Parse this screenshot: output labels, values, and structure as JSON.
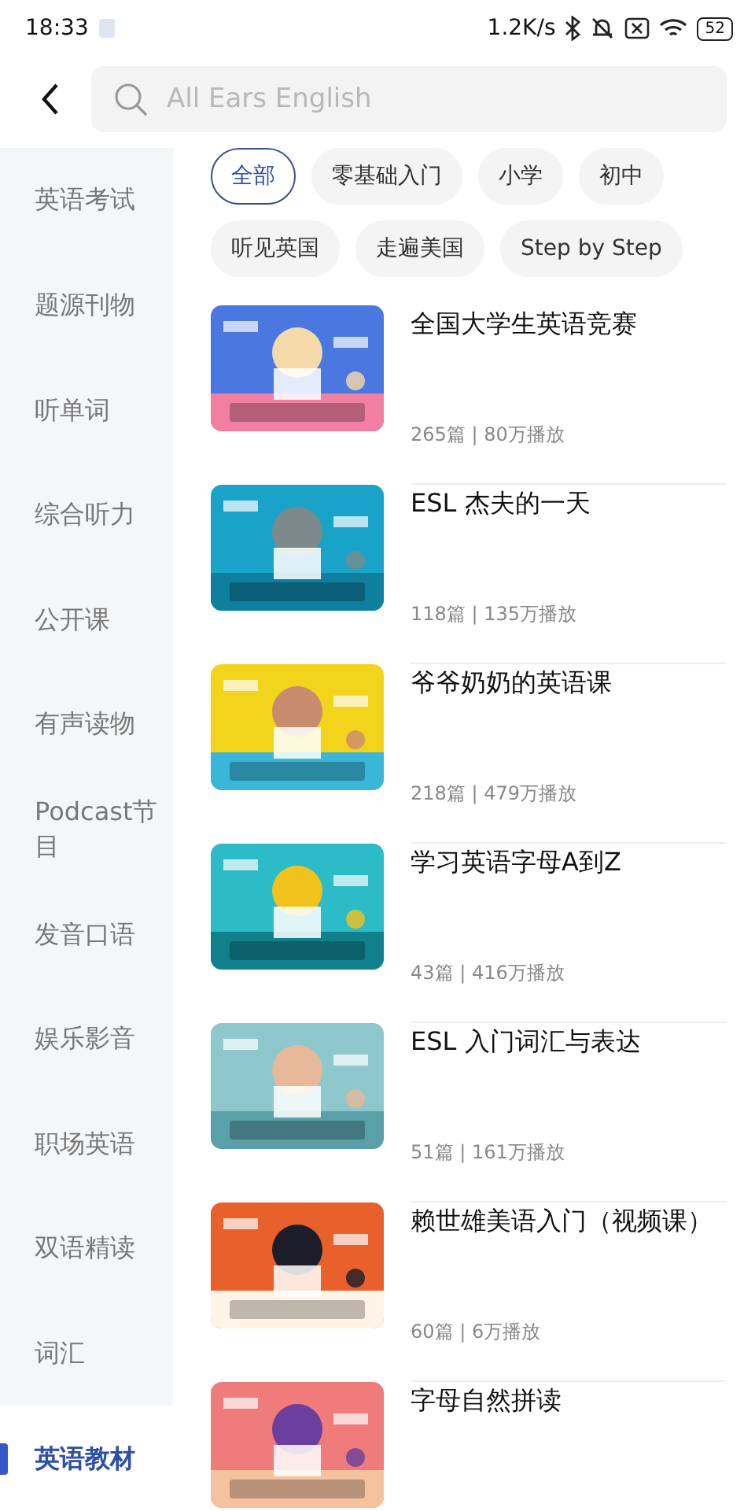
{
  "status_bar": {
    "time": "18:33",
    "speed": "1.2K/s",
    "battery": "52"
  },
  "search": {
    "placeholder": "All Ears English"
  },
  "sidebar": {
    "items": [
      {
        "label": "英语考试",
        "selected": false
      },
      {
        "label": "题源刊物",
        "selected": false
      },
      {
        "label": "听单词",
        "selected": false
      },
      {
        "label": "综合听力",
        "selected": false
      },
      {
        "label": "公开课",
        "selected": false
      },
      {
        "label": "有声读物",
        "selected": false
      },
      {
        "label": "Podcast节目",
        "selected": false
      },
      {
        "label": "发音口语",
        "selected": false
      },
      {
        "label": "娱乐影音",
        "selected": false
      },
      {
        "label": "职场英语",
        "selected": false
      },
      {
        "label": "双语精读",
        "selected": false
      },
      {
        "label": "词汇",
        "selected": false
      },
      {
        "label": "英语教材",
        "selected": true
      }
    ]
  },
  "filters": [
    {
      "label": "全部",
      "selected": true
    },
    {
      "label": "零基础入门",
      "selected": false
    },
    {
      "label": "小学",
      "selected": false
    },
    {
      "label": "初中",
      "selected": false
    },
    {
      "label": "听见英国",
      "selected": false
    },
    {
      "label": "走遍美国",
      "selected": false
    },
    {
      "label": "Step by Step",
      "selected": false
    }
  ],
  "courses": [
    {
      "title": "全国大学生英语竞赛",
      "stats": "265篇 | 80万播放"
    },
    {
      "title": "ESL 杰夫的一天",
      "stats": "118篇 | 135万播放"
    },
    {
      "title": "爷爷奶奶的英语课",
      "stats": "218篇 | 479万播放"
    },
    {
      "title": "学习英语字母A到Z",
      "stats": "43篇 | 416万播放"
    },
    {
      "title": "ESL 入门词汇与表达",
      "stats": "51篇 | 161万播放"
    },
    {
      "title": "赖世雄美语入门（视频课）",
      "stats": "60篇 | 6万播放"
    },
    {
      "title": "字母自然拼读"
    }
  ]
}
